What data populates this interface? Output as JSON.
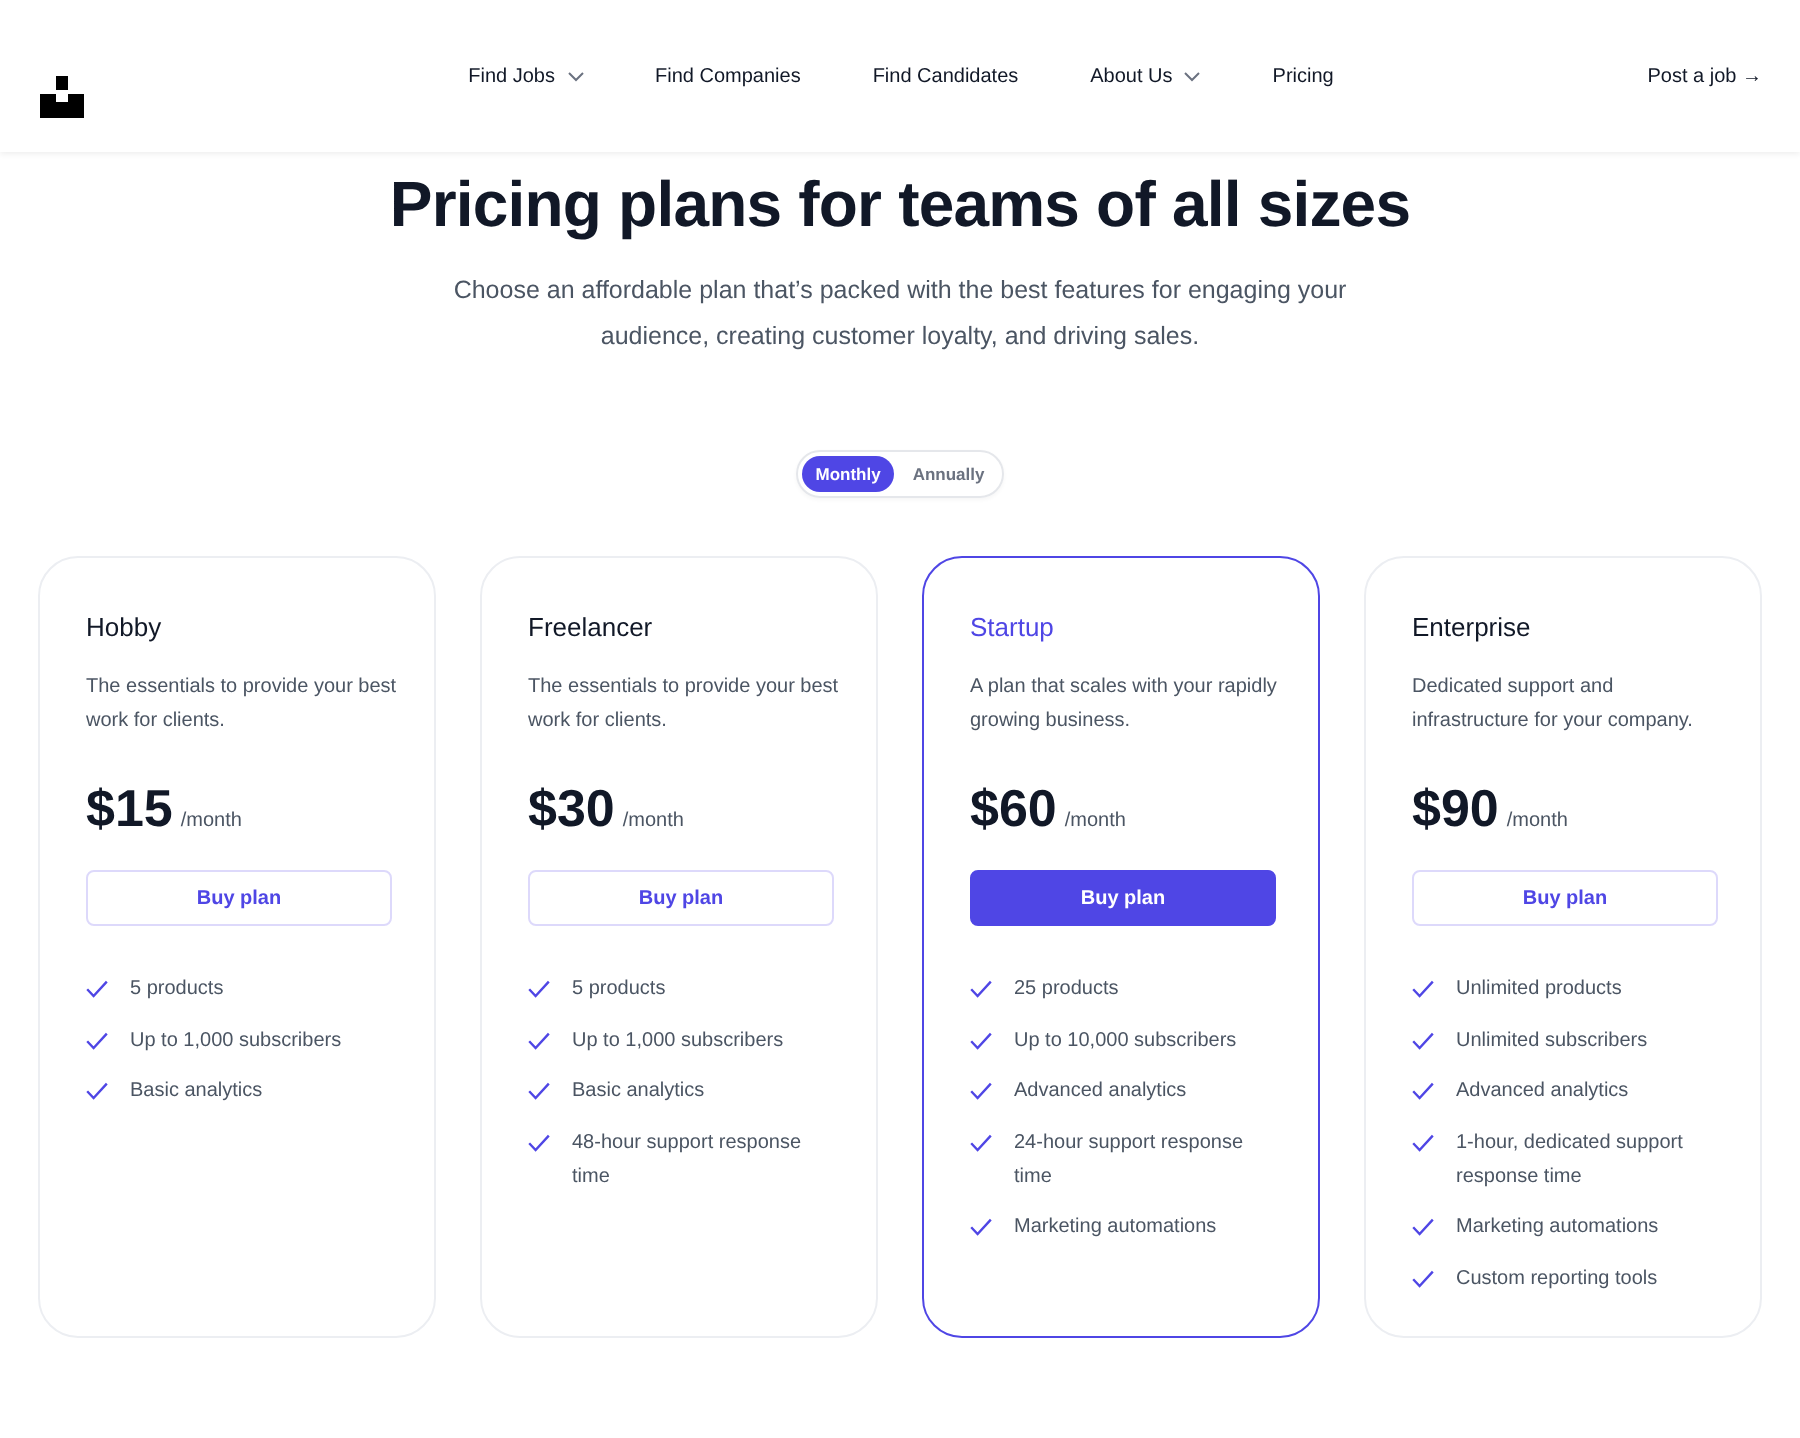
{
  "header": {
    "nav": [
      {
        "label": "Find Jobs",
        "has_menu": true
      },
      {
        "label": "Find Companies",
        "has_menu": false
      },
      {
        "label": "Find Candidates",
        "has_menu": false
      },
      {
        "label": "About Us",
        "has_menu": true
      },
      {
        "label": "Pricing",
        "has_menu": false
      }
    ],
    "cta": "Post a job →"
  },
  "hero": {
    "title": "Pricing plans for teams of all sizes",
    "subtitle": "Choose an affordable plan that’s packed with the best features for engaging your audience, creating customer loyalty, and driving sales."
  },
  "billing": {
    "options": [
      {
        "label": "Monthly",
        "selected": true
      },
      {
        "label": "Annually",
        "selected": false
      }
    ]
  },
  "plans": [
    {
      "name": "Hobby",
      "highlighted": false,
      "description": "The essentials to provide your best work for clients.",
      "price": "$15",
      "period": "/month",
      "button": "Buy plan",
      "features": [
        "5 products",
        "Up to 1,000 subscribers",
        "Basic analytics"
      ]
    },
    {
      "name": "Freelancer",
      "highlighted": false,
      "description": "The essentials to provide your best work for clients.",
      "price": "$30",
      "period": "/month",
      "button": "Buy plan",
      "features": [
        "5 products",
        "Up to 1,000 subscribers",
        "Basic analytics",
        "48-hour support response time"
      ]
    },
    {
      "name": "Startup",
      "highlighted": true,
      "description": "A plan that scales with your rapidly growing business.",
      "price": "$60",
      "period": "/month",
      "button": "Buy plan",
      "features": [
        "25 products",
        "Up to 10,000 subscribers",
        "Advanced analytics",
        "24-hour support response time",
        "Marketing automations"
      ]
    },
    {
      "name": "Enterprise",
      "highlighted": false,
      "description": "Dedicated support and infrastructure for your company.",
      "price": "$90",
      "period": "/month",
      "button": "Buy plan",
      "features": [
        "Unlimited products",
        "Unlimited subscribers",
        "Advanced analytics",
        "1-hour, dedicated support response time",
        "Marketing automations",
        "Custom reporting tools"
      ]
    }
  ]
}
